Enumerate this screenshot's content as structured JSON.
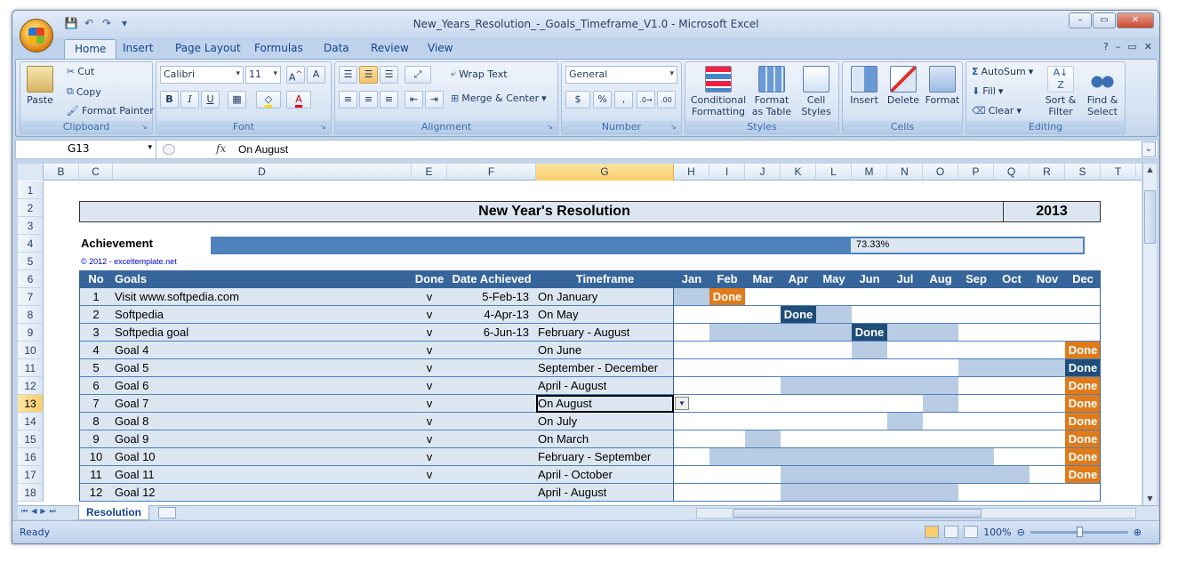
{
  "window": {
    "title": "New_Years_Resolution_-_Goals_Timeframe_V1.0 - Microsoft Excel",
    "controls": [
      "–",
      "▭",
      "✕"
    ]
  },
  "ribbon_tabs": [
    "Home",
    "Insert",
    "Page Layout",
    "Formulas",
    "Data",
    "Review",
    "View"
  ],
  "active_tab": "Home",
  "clipboard": {
    "paste": "Paste",
    "cut": "Cut",
    "copy": "Copy",
    "format_painter": "Format Painter",
    "label": "Clipboard"
  },
  "font": {
    "name": "Calibri",
    "size": "11",
    "label": "Font",
    "bold": "B",
    "italic": "I",
    "underline": "U"
  },
  "alignment": {
    "wrap": "Wrap Text",
    "merge": "Merge & Center",
    "label": "Alignment"
  },
  "number": {
    "format": "General",
    "currency": "$",
    "percent": "%",
    "comma": ",",
    "label": "Number"
  },
  "styles": {
    "conditional": "Conditional Formatting",
    "table": "Format as Table",
    "cell_styles": "Cell Styles",
    "label": "Styles"
  },
  "cells": {
    "insert": "Insert",
    "delete": "Delete",
    "format": "Format",
    "label": "Cells"
  },
  "editing": {
    "autosum": "AutoSum",
    "fill": "Fill",
    "clear": "Clear",
    "sort": "Sort & Filter",
    "find": "Find & Select",
    "label": "Editing"
  },
  "formula_bar": {
    "name_box": "G13",
    "fx": "fx",
    "value": "On August"
  },
  "columns": [
    "B",
    "C",
    "D",
    "E",
    "F",
    "G",
    "H",
    "I",
    "J",
    "K",
    "L",
    "M",
    "N",
    "O",
    "P",
    "Q",
    "R",
    "S",
    "T"
  ],
  "rows": [
    "1",
    "2",
    "3",
    "4",
    "5",
    "6",
    "7",
    "8",
    "9",
    "10",
    "11",
    "12",
    "13",
    "14",
    "15",
    "16",
    "17",
    "18"
  ],
  "sheet": {
    "title": "New Year's Resolution",
    "year": "2013",
    "achievement_label": "Achievement",
    "achievement_value": "73.33%",
    "achievement_fraction": 0.7333,
    "copyright": "© 2012 - exceltemplate.net",
    "headers": {
      "no": "No",
      "goals": "Goals",
      "done": "Done",
      "date": "Date Achieved",
      "timeframe": "Timeframe"
    },
    "months": [
      "Jan",
      "Feb",
      "Mar",
      "Apr",
      "May",
      "Jun",
      "Jul",
      "Aug",
      "Sep",
      "Oct",
      "Nov",
      "Dec"
    ],
    "goals": [
      {
        "no": "1",
        "goal": "Visit www.softpedia.com",
        "done": "v",
        "date": "5-Feb-13",
        "timeframe": "On January"
      },
      {
        "no": "2",
        "goal": "Softpedia",
        "done": "v",
        "date": "4-Apr-13",
        "timeframe": "On May"
      },
      {
        "no": "3",
        "goal": "Softpedia goal",
        "done": "v",
        "date": "6-Jun-13",
        "timeframe": "February - August"
      },
      {
        "no": "4",
        "goal": "Goal 4",
        "done": "v",
        "date": "",
        "timeframe": "On June"
      },
      {
        "no": "5",
        "goal": "Goal 5",
        "done": "v",
        "date": "",
        "timeframe": "September - December"
      },
      {
        "no": "6",
        "goal": "Goal 6",
        "done": "v",
        "date": "",
        "timeframe": "April - August"
      },
      {
        "no": "7",
        "goal": "Goal 7",
        "done": "v",
        "date": "",
        "timeframe": "On August"
      },
      {
        "no": "8",
        "goal": "Goal 8",
        "done": "v",
        "date": "",
        "timeframe": "On July"
      },
      {
        "no": "9",
        "goal": "Goal 9",
        "done": "v",
        "date": "",
        "timeframe": "On March"
      },
      {
        "no": "10",
        "goal": "Goal 10",
        "done": "v",
        "date": "",
        "timeframe": "February - September"
      },
      {
        "no": "11",
        "goal": "Goal 11",
        "done": "v",
        "date": "",
        "timeframe": "April - October"
      },
      {
        "no": "12",
        "goal": "Goal 12",
        "done": "",
        "date": "",
        "timeframe": "April - August"
      }
    ],
    "done_label": "Done",
    "timeline": [
      {
        "range": [
          1,
          1
        ],
        "done_month": 2,
        "done_color": "#e07b1a"
      },
      {
        "range": [
          5,
          5
        ],
        "done_month": 4,
        "done_color": "#1f4e79"
      },
      {
        "range": [
          2,
          8
        ],
        "done_month": 6,
        "done_color": "#1f4e79"
      },
      {
        "range": [
          6,
          6
        ],
        "done_month": 12,
        "done_color": "#e07b1a"
      },
      {
        "range": [
          9,
          12
        ],
        "done_month": 12,
        "done_color": "#1f4e79"
      },
      {
        "range": [
          4,
          8
        ],
        "done_month": 12,
        "done_color": "#e07b1a"
      },
      {
        "range": [
          8,
          8
        ],
        "done_month": 12,
        "done_color": "#e07b1a"
      },
      {
        "range": [
          7,
          7
        ],
        "done_month": 12,
        "done_color": "#e07b1a"
      },
      {
        "range": [
          3,
          3
        ],
        "done_month": 12,
        "done_color": "#e07b1a"
      },
      {
        "range": [
          2,
          9
        ],
        "done_month": 12,
        "done_color": "#e07b1a"
      },
      {
        "range": [
          4,
          10
        ],
        "done_month": 12,
        "done_color": "#e07b1a"
      },
      {
        "range": [
          4,
          8
        ],
        "done_month": 0,
        "done_color": ""
      }
    ]
  },
  "sheet_tab": "Resolution",
  "status": {
    "ready": "Ready",
    "zoom": "100%"
  },
  "colors": {
    "header_blue": "#36659b",
    "band": "#dce6f1",
    "timeline_fill": "#b8cce4",
    "orange": "#e07b1a",
    "dark_blue": "#1f4e79"
  }
}
